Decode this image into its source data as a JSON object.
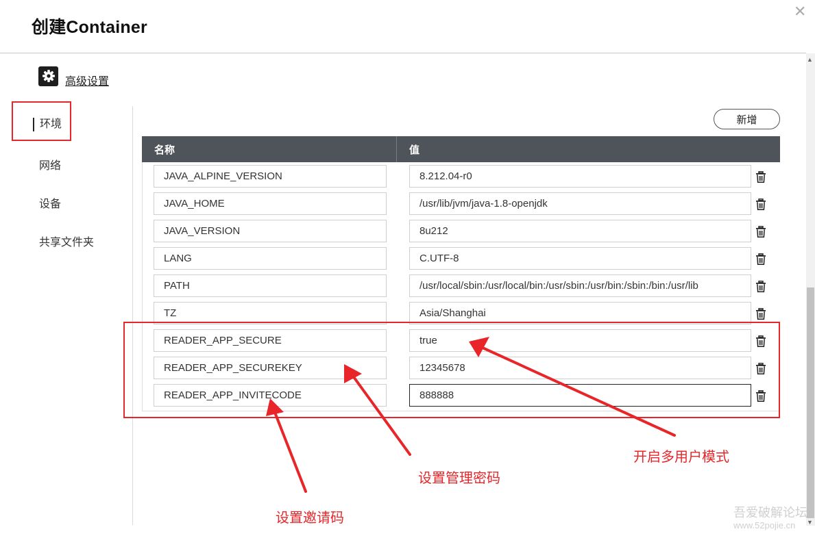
{
  "dialog": {
    "title": "创建Container",
    "close_icon": "close-icon"
  },
  "advanced": {
    "label": "高级设置",
    "icon": "gear-icon"
  },
  "sidebar": {
    "items": [
      {
        "label": "环境",
        "active": true
      },
      {
        "label": "网络"
      },
      {
        "label": "设备"
      },
      {
        "label": "共享文件夹"
      }
    ]
  },
  "toolbar": {
    "add_label": "新增"
  },
  "table": {
    "headers": {
      "name": "名称",
      "value": "值"
    },
    "rows": [
      {
        "name": "JAVA_ALPINE_VERSION",
        "value": "8.212.04-r0"
      },
      {
        "name": "JAVA_HOME",
        "value": "/usr/lib/jvm/java-1.8-openjdk"
      },
      {
        "name": "JAVA_VERSION",
        "value": "8u212"
      },
      {
        "name": "LANG",
        "value": "C.UTF-8"
      },
      {
        "name": "PATH",
        "value": "/usr/local/sbin:/usr/local/bin:/usr/sbin:/usr/bin:/sbin:/bin:/usr/lib"
      },
      {
        "name": "TZ",
        "value": "Asia/Shanghai"
      },
      {
        "name": "READER_APP_SECURE",
        "value": "true"
      },
      {
        "name": "READER_APP_SECUREKEY",
        "value": "12345678"
      },
      {
        "name": "READER_APP_INVITECODE",
        "value": "888888"
      }
    ],
    "row_delete_icon": "trash-icon"
  },
  "annotations": {
    "multi_user": "开启多用户模式",
    "admin_password": "设置管理密码",
    "invite_code": "设置邀请码",
    "color": "#e8262a"
  },
  "watermark": {
    "line1": "吾爱破解论坛",
    "line2": "www.52pojie.cn"
  }
}
